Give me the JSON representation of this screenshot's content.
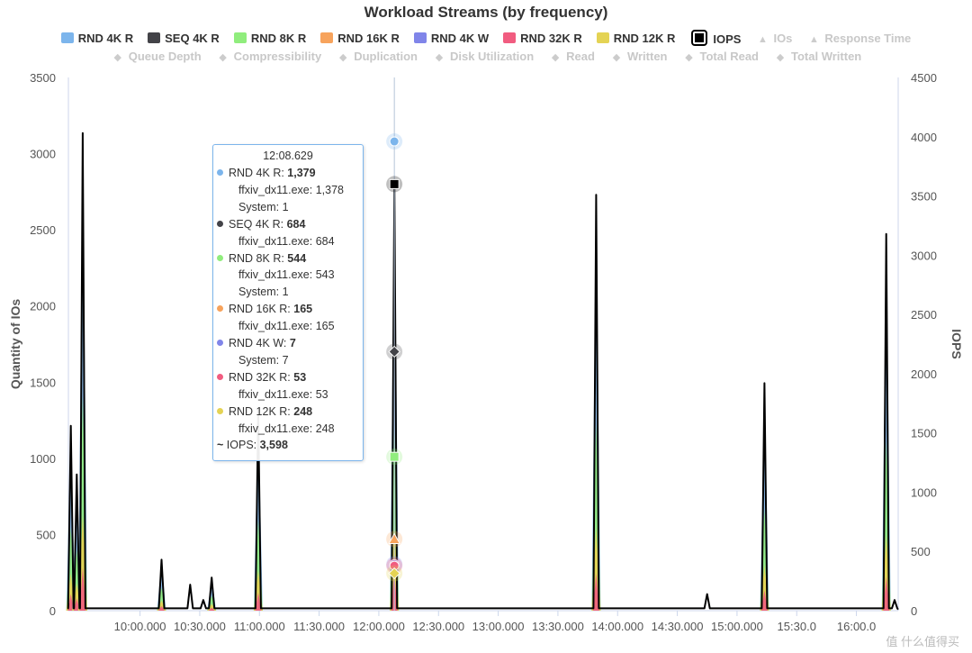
{
  "chart_data": {
    "type": "area",
    "title": "Workload Streams (by frequency)",
    "ylabel": "Quantity of IOs",
    "y2label": "IOPS",
    "ylim": [
      0,
      3500
    ],
    "y2lim": [
      0,
      4500
    ],
    "yticks": [
      "0",
      "500",
      "1000",
      "1500",
      "2000",
      "2500",
      "3000",
      "3500"
    ],
    "y2ticks": [
      "0",
      "500",
      "1000",
      "1500",
      "2000",
      "2500",
      "3000",
      "3500",
      "4000",
      "4500"
    ],
    "xticks": [
      "10:00.000",
      "10:30.000",
      "11:00.000",
      "11:30.000",
      "12:00.000",
      "12:30.000",
      "13:00.000",
      "13:30.000",
      "14:00.000",
      "14:30.000",
      "15:00.000",
      "15:30.0",
      "16:00.0"
    ],
    "x_unit": "minute",
    "xlim": [
      9.4,
      16.35
    ],
    "grid": false,
    "legend_position": "top",
    "series_active": [
      {
        "name": "RND 4K R",
        "color": "#7cb5ec"
      },
      {
        "name": "SEQ 4K R",
        "color": "#434348"
      },
      {
        "name": "RND 8K R",
        "color": "#90ed7d"
      },
      {
        "name": "RND 16K R",
        "color": "#f7a35c"
      },
      {
        "name": "RND 4K W",
        "color": "#8085e9"
      },
      {
        "name": "RND 32K R",
        "color": "#f15c80"
      },
      {
        "name": "RND 12K R",
        "color": "#e4d354"
      },
      {
        "name": "IOPS",
        "color": "#000000"
      }
    ],
    "series_hidden_row1": [
      "IOs",
      "Response Time"
    ],
    "series_hidden_row2": [
      "Queue Depth",
      "Compressibility",
      "Duplication",
      "Disk Utilization",
      "Read",
      "Written",
      "Total Read",
      "Total Written"
    ],
    "iops_spikes": [
      {
        "x": 9.42,
        "iops": 1560
      },
      {
        "x": 9.47,
        "iops": 1150
      },
      {
        "x": 9.52,
        "iops": 4030
      },
      {
        "x": 10.18,
        "iops": 430
      },
      {
        "x": 10.42,
        "iops": 220
      },
      {
        "x": 10.53,
        "iops": 90
      },
      {
        "x": 10.6,
        "iops": 280
      },
      {
        "x": 10.99,
        "iops": 1700
      },
      {
        "x": 12.13,
        "iops": 3598
      },
      {
        "x": 13.82,
        "iops": 3510
      },
      {
        "x": 14.75,
        "iops": 140
      },
      {
        "x": 15.23,
        "iops": 1920
      },
      {
        "x": 16.25,
        "iops": 3180
      },
      {
        "x": 16.32,
        "iops": 90
      }
    ],
    "highlight_x": 12.13,
    "highlight_points": [
      {
        "series": "RND 4K R",
        "y": 3080,
        "color": "#7cb5ec",
        "shape": "circle"
      },
      {
        "series": "IOPS",
        "y": 2800,
        "color": "#000000",
        "shape": "square"
      },
      {
        "series": "SEQ 4K R",
        "y": 1700,
        "color": "#434348",
        "shape": "diamond"
      },
      {
        "series": "RND 8K R",
        "y": 1010,
        "color": "#90ed7d",
        "shape": "square"
      },
      {
        "series": "RND 16K R",
        "y": 470,
        "color": "#f7a35c",
        "shape": "triangle"
      },
      {
        "series": "RND 4K W",
        "y": 305,
        "color": "#8085e9",
        "shape": "circle"
      },
      {
        "series": "RND 32K R",
        "y": 295,
        "color": "#f15c80",
        "shape": "circle"
      },
      {
        "series": "RND 12K R",
        "y": 245,
        "color": "#e4d354",
        "shape": "diamond"
      }
    ]
  },
  "tooltip": {
    "time": "12:08.629",
    "rows": [
      {
        "kind": "main",
        "color": "#7cb5ec",
        "label": "RND 4K R: ",
        "value": "1,379"
      },
      {
        "kind": "sub",
        "text": "ffxiv_dx11.exe: 1,378"
      },
      {
        "kind": "sub",
        "text": "System: 1"
      },
      {
        "kind": "main",
        "color": "#434348",
        "label": "SEQ 4K R: ",
        "value": "684"
      },
      {
        "kind": "sub",
        "text": "ffxiv_dx11.exe: 684"
      },
      {
        "kind": "main",
        "color": "#90ed7d",
        "label": "RND 8K R: ",
        "value": "544"
      },
      {
        "kind": "sub",
        "text": "ffxiv_dx11.exe: 543"
      },
      {
        "kind": "sub",
        "text": "System: 1"
      },
      {
        "kind": "main",
        "color": "#f7a35c",
        "label": "RND 16K R: ",
        "value": "165"
      },
      {
        "kind": "sub",
        "text": "ffxiv_dx11.exe: 165"
      },
      {
        "kind": "main",
        "color": "#8085e9",
        "label": "RND 4K W: ",
        "value": "7"
      },
      {
        "kind": "sub",
        "text": "System: 7"
      },
      {
        "kind": "main",
        "color": "#f15c80",
        "label": "RND 32K R: ",
        "value": "53"
      },
      {
        "kind": "sub",
        "text": "ffxiv_dx11.exe: 53"
      },
      {
        "kind": "main",
        "color": "#e4d354",
        "label": "RND 12K R: ",
        "value": "248"
      },
      {
        "kind": "sub",
        "text": "ffxiv_dx11.exe: 248"
      },
      {
        "kind": "iops",
        "color": "#000000",
        "label": "IOPS: ",
        "value": "3,598"
      }
    ]
  },
  "watermark": "值 什么值得买"
}
